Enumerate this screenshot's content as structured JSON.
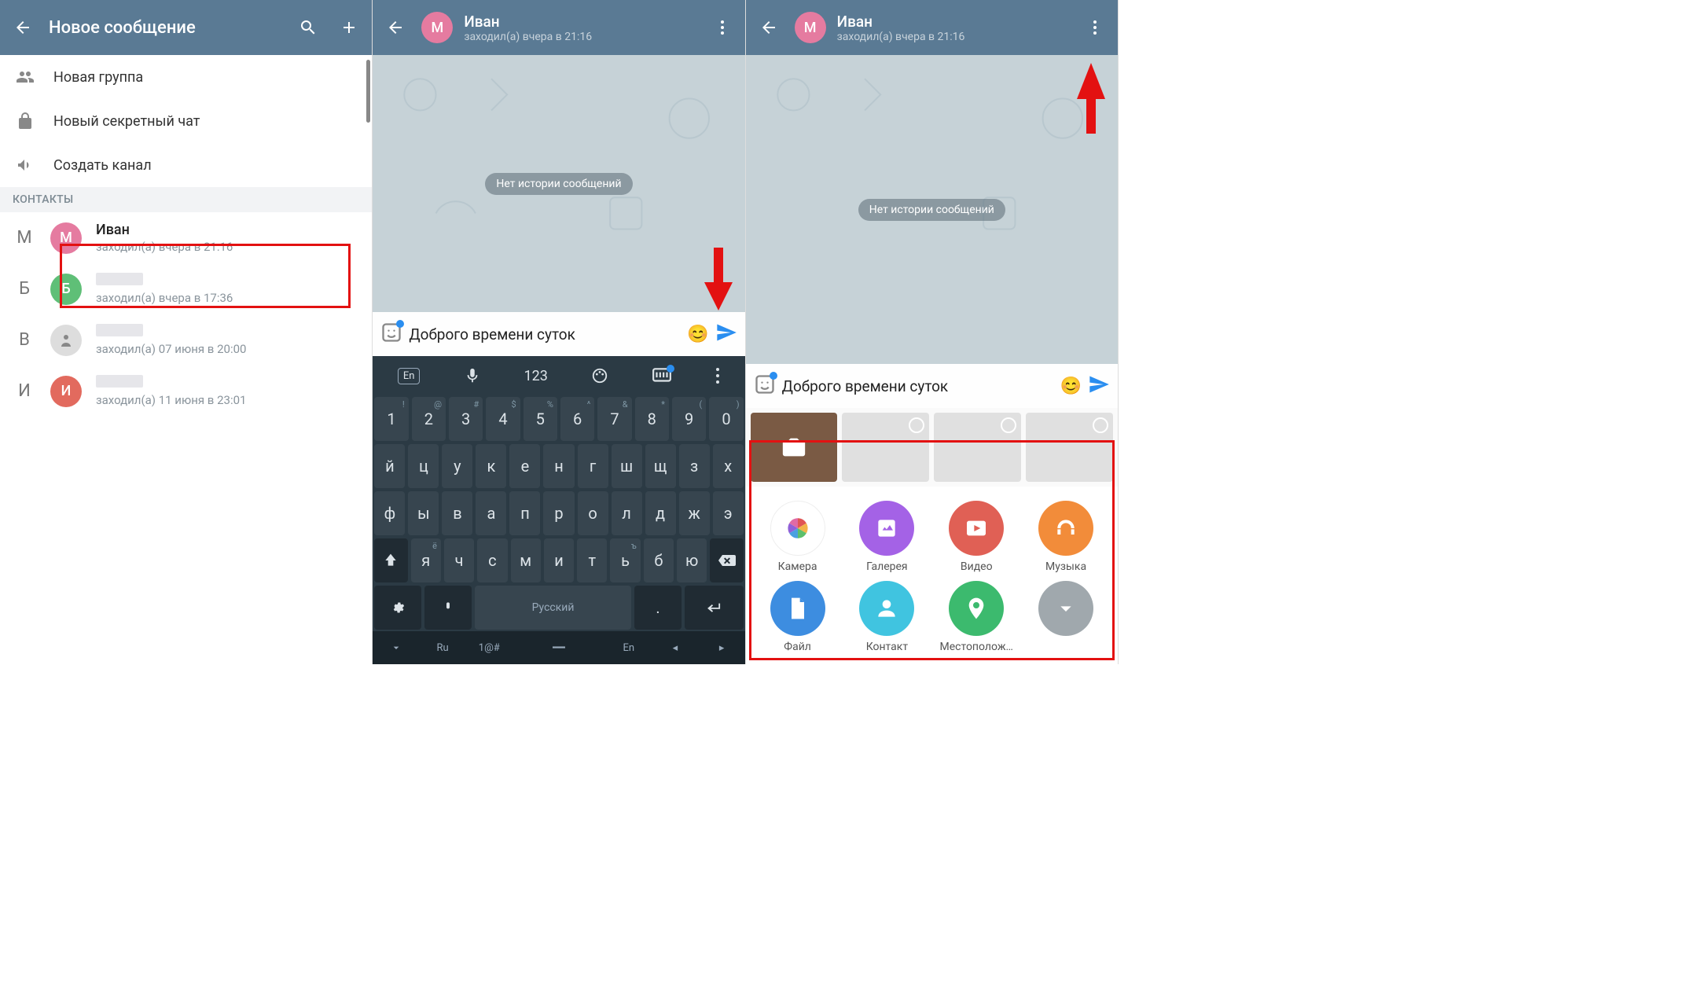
{
  "screen1": {
    "title": "Новое сообщение",
    "options": {
      "new_group": "Новая группа",
      "new_secret": "Новый секретный чат",
      "new_channel": "Создать канал"
    },
    "section_contacts": "КОНТАКТЫ",
    "contacts": [
      {
        "letter": "М",
        "avatar_letter": "М",
        "avatar_color": "pink",
        "name": "Иван",
        "status": "заходил(а) вчера в 21:16"
      },
      {
        "letter": "Б",
        "avatar_letter": "Б",
        "avatar_color": "green",
        "name": "",
        "status": "заходил(а) вчера в 17:36"
      },
      {
        "letter": "В",
        "avatar_letter": "",
        "avatar_color": "photo",
        "name": "",
        "status": "заходил(а) 07 июня в 20:00"
      },
      {
        "letter": "И",
        "avatar_letter": "И",
        "avatar_color": "red",
        "name": "",
        "status": "заходил(а) 11 июня в 23:01"
      }
    ]
  },
  "chat_header": {
    "avatar_letter": "М",
    "name": "Иван",
    "status": "заходил(а) вчера в 21:16"
  },
  "chat_body": {
    "no_history": "Нет истории сообщений"
  },
  "input": {
    "message": "Доброго времени суток "
  },
  "keyboard": {
    "lang_label": "En",
    "num_label": "123",
    "row_num": [
      "1",
      "2",
      "3",
      "4",
      "5",
      "6",
      "7",
      "8",
      "9",
      "0"
    ],
    "row_num_sub": [
      "!",
      "@",
      "#",
      "$",
      "%",
      "^",
      "&",
      "*",
      "(",
      ")"
    ],
    "row1": [
      "й",
      "ц",
      "у",
      "к",
      "е",
      "н",
      "г",
      "ш",
      "щ",
      "з",
      "х"
    ],
    "row2": [
      "ф",
      "ы",
      "в",
      "а",
      "п",
      "р",
      "о",
      "л",
      "д",
      "ж",
      "э"
    ],
    "row3": [
      "я",
      "ч",
      "с",
      "м",
      "и",
      "т",
      "ь",
      "б",
      "ю"
    ],
    "row3_sub_1": "ё",
    "row3_sub_last": "ъ",
    "space_label": "Русский",
    "enter_ru": ".",
    "bottom_ru": "Ru",
    "bottom_sym": "1@#",
    "bottom_en": "En"
  },
  "attach": {
    "items": [
      {
        "label": "Камера",
        "color": "camera"
      },
      {
        "label": "Галерея",
        "color": "#a462e6"
      },
      {
        "label": "Видео",
        "color": "#e06055"
      },
      {
        "label": "Музыка",
        "color": "#f28c3a"
      },
      {
        "label": "Файл",
        "color": "#3d8de0"
      },
      {
        "label": "Контакт",
        "color": "#40c4e0"
      },
      {
        "label": "Местополож…",
        "color": "#3cba6e"
      },
      {
        "label": "",
        "color": "#a0a8ad"
      }
    ]
  }
}
